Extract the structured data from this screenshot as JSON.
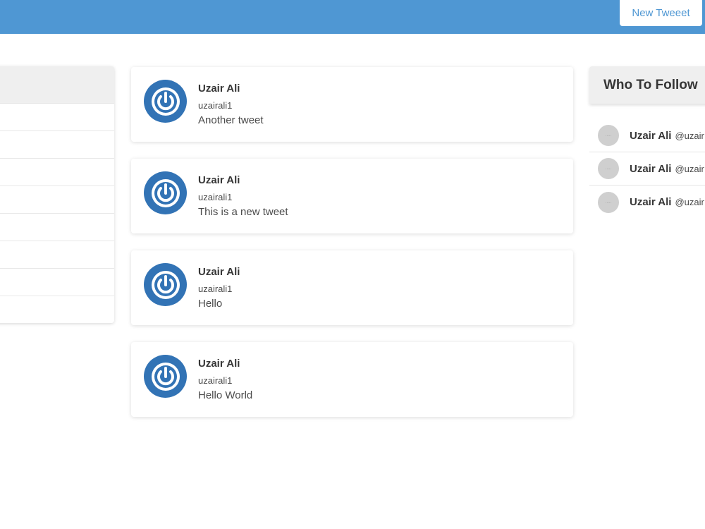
{
  "header": {
    "new_tweet_label": "New Tweeet",
    "bar_color": "#4f97d3"
  },
  "left_panel": {
    "row_count_visible": 8
  },
  "tweets": [
    {
      "name": "Uzair Ali",
      "handle": "uzairali1",
      "text": "Another tweet",
      "avatar_icon": "power-icon"
    },
    {
      "name": "Uzair Ali",
      "handle": "uzairali1",
      "text": "This is a new tweet",
      "avatar_icon": "power-icon"
    },
    {
      "name": "Uzair Ali",
      "handle": "uzairali1",
      "text": "Hello",
      "avatar_icon": "power-icon"
    },
    {
      "name": "Uzair Ali",
      "handle": "uzairali1",
      "text": "Hello World",
      "avatar_icon": "power-icon"
    }
  ],
  "who_to_follow": {
    "title": "Who To Follow",
    "items": [
      {
        "name": "Uzair Ali",
        "handle": "@uzair",
        "avatar_placeholder": "....."
      },
      {
        "name": "Uzair Ali",
        "handle": "@uzair",
        "avatar_placeholder": "....."
      },
      {
        "name": "Uzair Ali",
        "handle": "@uzair",
        "avatar_placeholder": "....."
      }
    ]
  },
  "colors": {
    "accent": "#4f97d3",
    "avatar_blue": "#3273b5",
    "panel_header": "#efefef"
  }
}
